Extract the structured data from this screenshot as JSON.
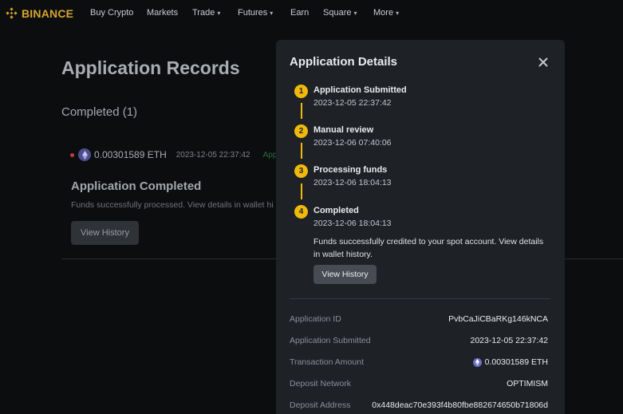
{
  "nav": {
    "brand": "BINANCE",
    "items": [
      {
        "label": "Buy Crypto",
        "dropdown": false
      },
      {
        "label": "Markets",
        "dropdown": false
      },
      {
        "label": "Trade",
        "dropdown": true
      },
      {
        "label": "Futures",
        "dropdown": true
      },
      {
        "label": "Earn",
        "dropdown": false
      },
      {
        "label": "Square",
        "dropdown": true
      },
      {
        "label": "More",
        "dropdown": true
      }
    ]
  },
  "page": {
    "title": "Application Records",
    "section_title": "Completed (1)",
    "record": {
      "amount": "0.00301589 ETH",
      "time": "2023-12-05 22:37:42",
      "status": "App"
    },
    "completed_title": "Application Completed",
    "completed_desc": "Funds successfully processed. View details in wallet hi",
    "view_history": "View History"
  },
  "modal": {
    "title": "Application Details",
    "steps": [
      {
        "num": "1",
        "label": "Application Submitted",
        "time": "2023-12-05 22:37:42"
      },
      {
        "num": "2",
        "label": "Manual review",
        "time": "2023-12-06 07:40:06"
      },
      {
        "num": "3",
        "label": "Processing funds",
        "time": "2023-12-06 18:04:13"
      },
      {
        "num": "4",
        "label": "Completed",
        "time": "2023-12-06 18:04:13"
      }
    ],
    "final_desc": "Funds successfully credited to your spot account. View details in wallet history.",
    "view_history": "View History",
    "details": [
      {
        "label": "Application ID",
        "value": "PvbCaJiCBaRKg146kNCA"
      },
      {
        "label": "Application Submitted",
        "value": "2023-12-05 22:37:42"
      },
      {
        "label": "Transaction Amount",
        "value": "0.00301589 ETH"
      },
      {
        "label": "Deposit Network",
        "value": "OPTIMISM"
      },
      {
        "label": "Deposit Address",
        "value": "0x448deac70e393f4b80fbe882674650b71806d"
      }
    ]
  },
  "colors": {
    "brand": "#f0b90b",
    "background": "#0c0d0f",
    "modal": "#1e2126",
    "status_red": "#c23b3b"
  },
  "icons": {
    "logo": "binance-diamond-icon",
    "close": "close-icon",
    "coin": "ethereum-icon",
    "dropdown": "chevron-down-icon"
  }
}
